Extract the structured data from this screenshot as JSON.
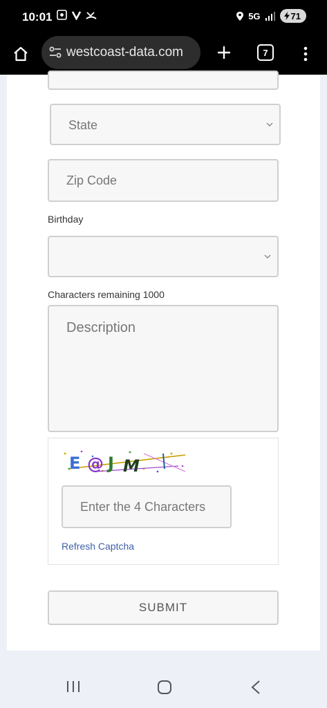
{
  "status_bar": {
    "time": "10:01",
    "network": "5G",
    "battery_level": "71"
  },
  "browser": {
    "url": "westcoast-data.com",
    "tab_count": "7"
  },
  "form": {
    "state_placeholder": "State",
    "zip_placeholder": "Zip Code",
    "birthday_label": "Birthday",
    "chars_remaining_label": "Characters remaining 1000",
    "description_placeholder": "Description",
    "captcha_placeholder": "Enter the 4 Characters",
    "refresh_captcha_label": "Refresh Captcha",
    "submit_label": "SUBMIT"
  },
  "icons": {
    "home": "home-icon",
    "site_settings": "tune-icon",
    "new_tab": "plus-icon",
    "menu": "more-vert-icon",
    "chevron": "chevron-down-icon",
    "nav_recents": "recents-icon",
    "nav_home": "nav-home-icon",
    "nav_back": "back-icon"
  }
}
